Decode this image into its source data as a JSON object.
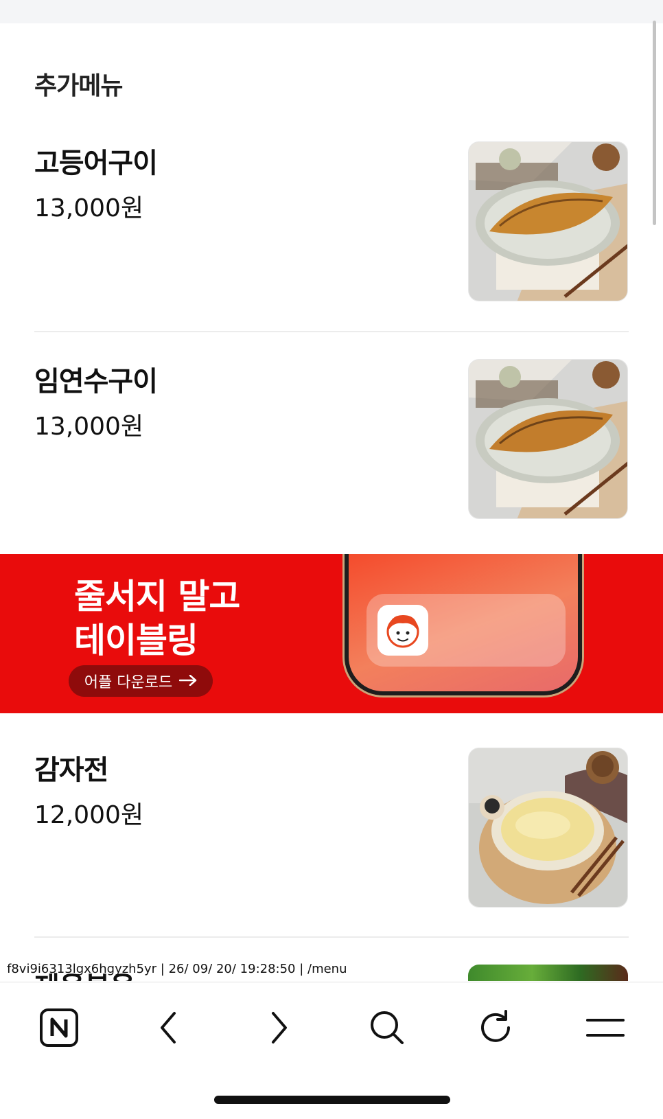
{
  "page": {
    "section_title": "추가메뉴"
  },
  "menu_items": [
    {
      "name": "고등어구이",
      "price": "13,000원",
      "photo": "grilled-mackerel"
    },
    {
      "name": "임연수구이",
      "price": "13,000원",
      "photo": "grilled-atka-mackerel"
    },
    {
      "name": "감자전",
      "price": "12,000원",
      "photo": "potato-pancake"
    },
    {
      "name": "제육볶음",
      "photo": "salad-greens"
    }
  ],
  "banner": {
    "headline_line1": "줄서지 말고",
    "headline_line2": "테이블링",
    "cta_label": "어플 다운로드",
    "cta_icon": "arrow-right-icon",
    "app_icon": "tabling-mascot-icon",
    "color": "#e90c0c"
  },
  "debug_overlay": {
    "text": "f8vi9i6313lgx6hgyzh5yr | 26/ 09/ 20/ 19:28:50 | /menu"
  },
  "browser_toolbar": {
    "buttons": [
      {
        "name": "naver-home-icon"
      },
      {
        "name": "back-arrow-icon"
      },
      {
        "name": "forward-arrow-icon"
      },
      {
        "name": "search-icon"
      },
      {
        "name": "refresh-icon"
      },
      {
        "name": "menu-icon"
      }
    ]
  }
}
